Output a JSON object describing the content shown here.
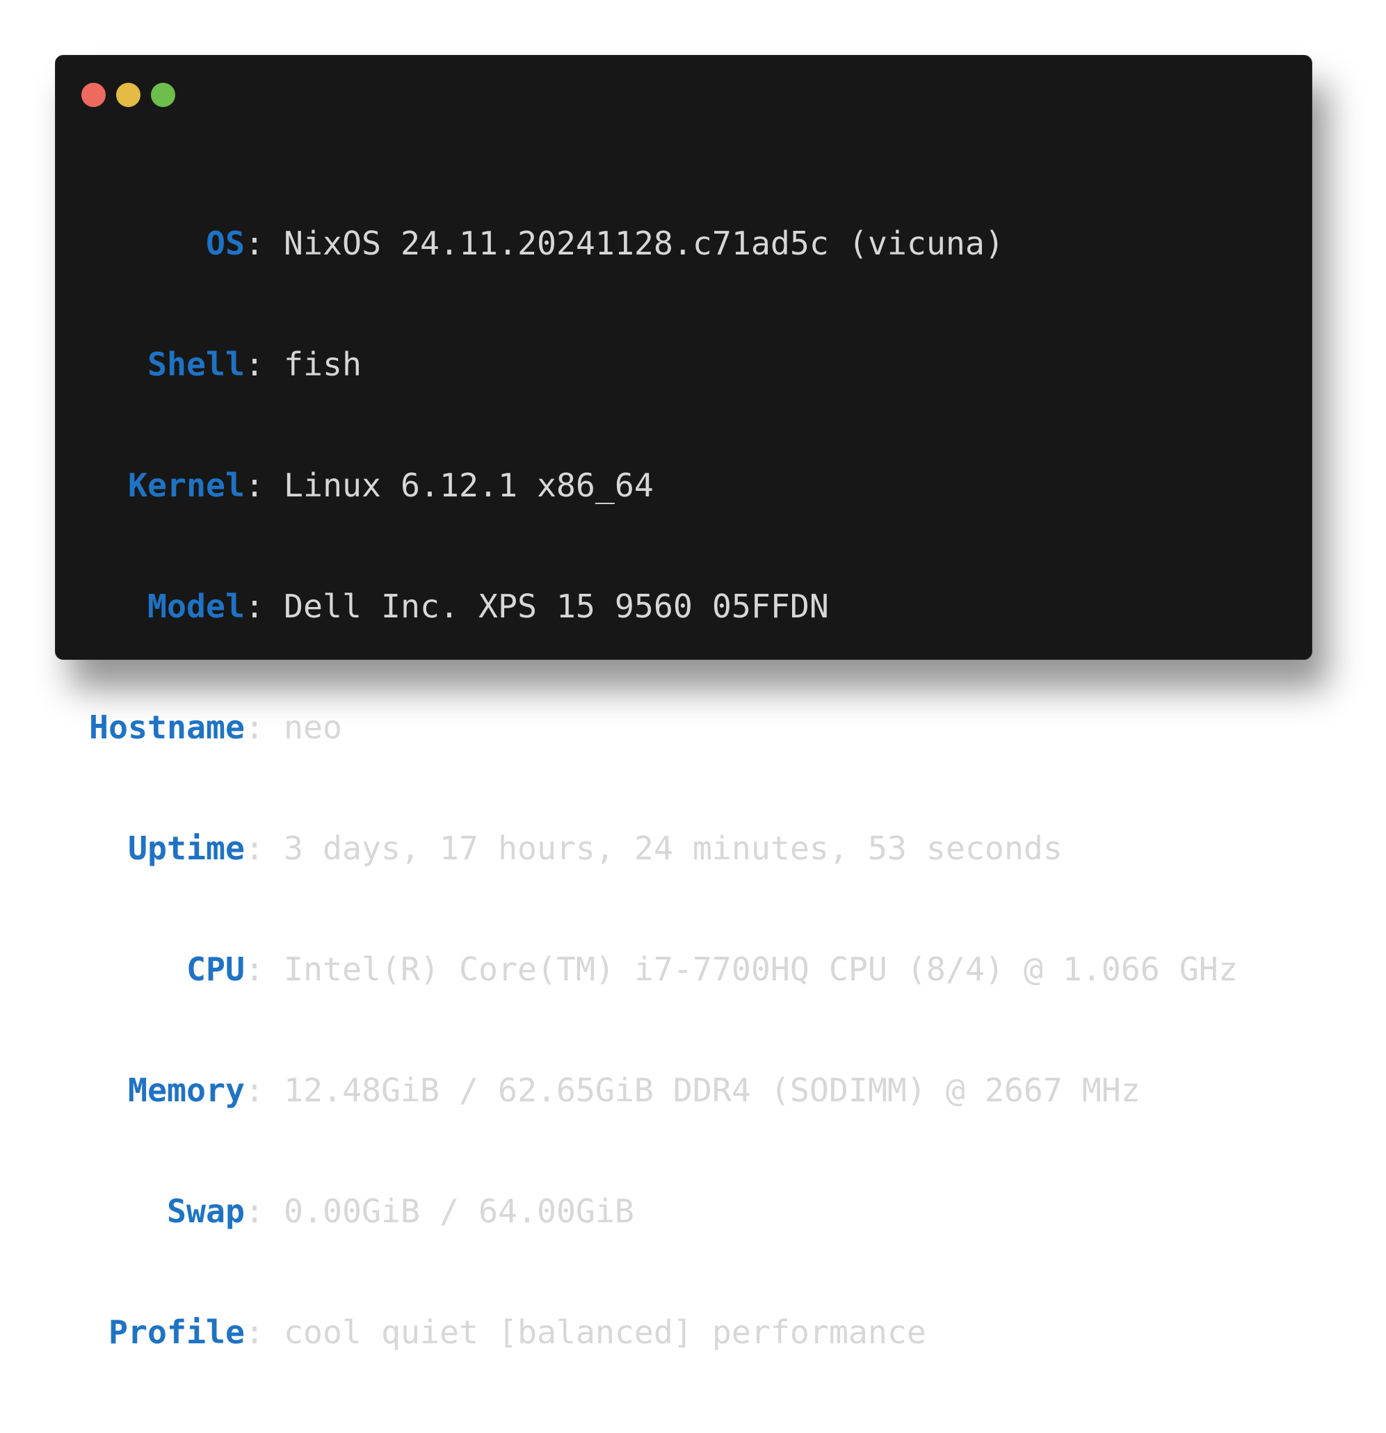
{
  "window": {
    "controls": [
      "close",
      "minimize",
      "maximize"
    ],
    "colors": {
      "close": "#ee6a5f",
      "minimize": "#e3bb45",
      "maximize": "#6dbe4b",
      "background": "#171717",
      "label": "#1f73c4",
      "text": "#d7d7d7"
    }
  },
  "info": {
    "separator": ":",
    "rows": [
      {
        "key": "OS",
        "value": "NixOS 24.11.20241128.c71ad5c (vicuna)"
      },
      {
        "key": "Shell",
        "value": "fish"
      },
      {
        "key": "Kernel",
        "value": "Linux 6.12.1 x86_64"
      },
      {
        "key": "Model",
        "value": "Dell Inc. XPS 15 9560 05FFDN"
      },
      {
        "key": "Hostname",
        "value": "neo"
      },
      {
        "key": "Uptime",
        "value": "3 days, 17 hours, 24 minutes, 53 seconds"
      },
      {
        "key": "CPU",
        "value": "Intel(R) Core(TM) i7-7700HQ CPU (8/4) @ 1.066 GHz"
      },
      {
        "key": "Memory",
        "value": "12.48GiB / 62.65GiB DDR4 (SODIMM) @ 2667 MHz"
      },
      {
        "key": "Swap",
        "value": "0.00GiB / 64.00GiB"
      },
      {
        "key": "Profile",
        "value": "cool quiet [balanced] performance"
      }
    ]
  }
}
